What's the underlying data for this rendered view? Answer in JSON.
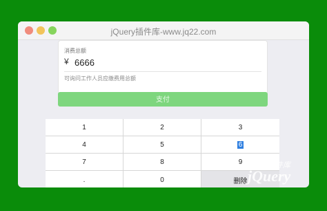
{
  "window": {
    "title": "jQuery插件库-www.jq22.com"
  },
  "payment": {
    "amount_label": "消费总额",
    "currency_symbol": "¥",
    "amount_value": "6666",
    "hint": "可询问工作人员应缴费用总额",
    "pay_label": "支付"
  },
  "keypad": {
    "keys": [
      "1",
      "2",
      "3",
      "4",
      "5",
      "6",
      "7",
      "8",
      "9",
      ".",
      "0",
      "删除"
    ]
  },
  "watermark": {
    "brand": "jQuery",
    "sub": "插件库"
  },
  "colors": {
    "background": "#0a8c0a",
    "pay_button": "#7ed67e",
    "selection": "#2f7fe0"
  }
}
